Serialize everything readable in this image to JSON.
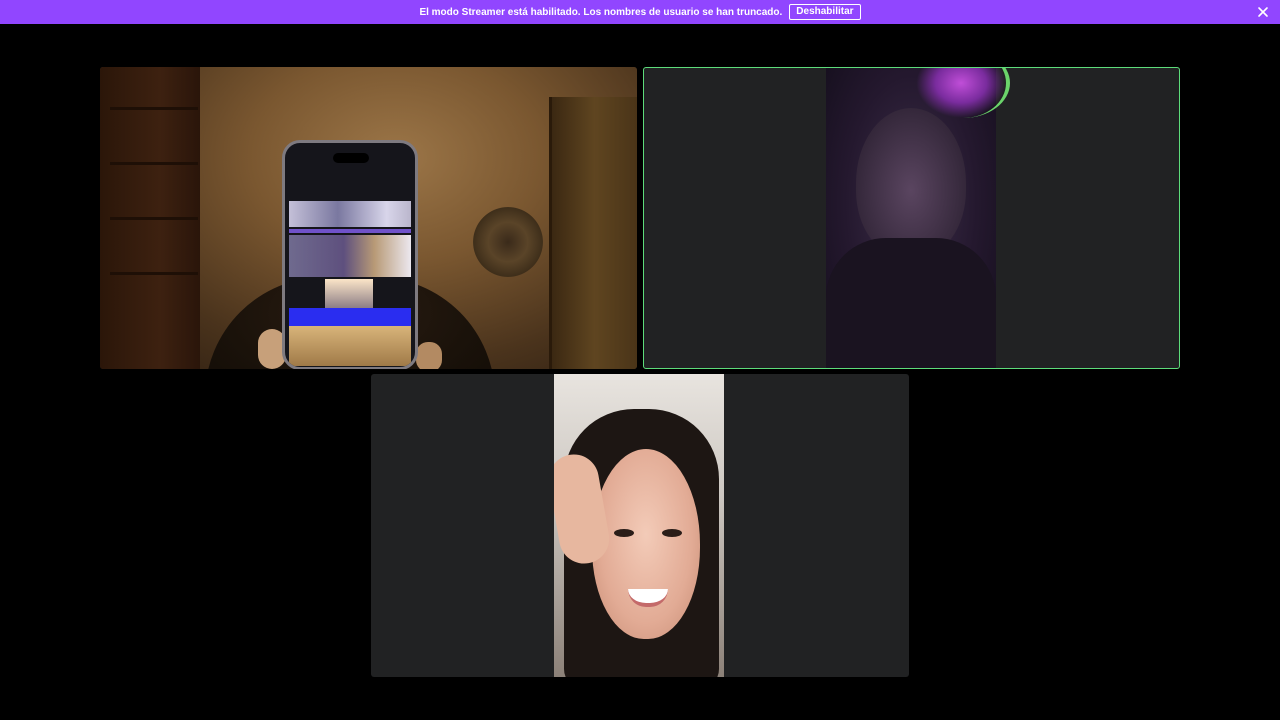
{
  "banner": {
    "message": "El modo Streamer está habilitado. Los nombres de usuario se han truncado.",
    "disable_label": "Deshabilitar",
    "close_icon": "close-icon",
    "color": "#9146ff"
  },
  "participants": [
    {
      "speaking": false
    },
    {
      "speaking": true
    },
    {
      "speaking": false
    }
  ],
  "colors": {
    "tile_bg": "#212223",
    "speaking_outline": "#5ddc7a",
    "page_bg": "#000000"
  }
}
